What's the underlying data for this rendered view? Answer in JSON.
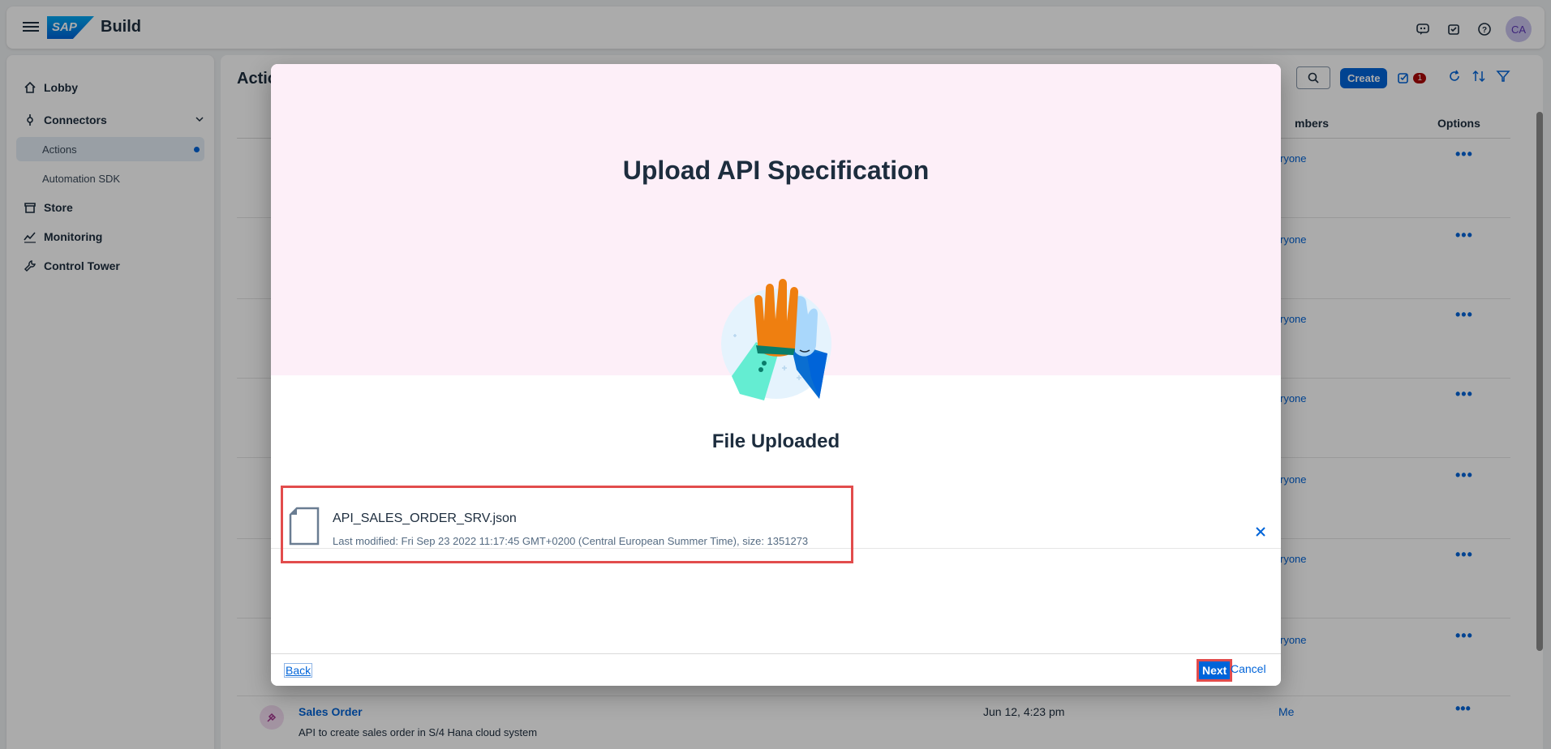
{
  "shell": {
    "brand_logo": "SAP",
    "brand_name": "Build",
    "avatar_initials": "CA"
  },
  "sidenav": {
    "items": [
      {
        "label": "Lobby",
        "icon": "home-icon"
      },
      {
        "label": "Connectors",
        "icon": "connector-icon"
      },
      {
        "label": "Actions",
        "icon": ""
      },
      {
        "label": "Automation SDK",
        "icon": ""
      },
      {
        "label": "Store",
        "icon": "store-icon"
      },
      {
        "label": "Monitoring",
        "icon": "monitoring-icon"
      },
      {
        "label": "Control Tower",
        "icon": "wrench-icon"
      }
    ]
  },
  "content": {
    "title": "Actio",
    "create_label": "Create",
    "notification_count": "1",
    "columns": {
      "members": "mbers",
      "options": "Options"
    },
    "row_member_partial": "ryone",
    "options_glyph": "•••",
    "last_row": {
      "name": "Sales Order",
      "description": "API to create sales order in S/4 Hana cloud system",
      "date": "Jun 12, 4:23 pm",
      "member": "Me"
    }
  },
  "dialog": {
    "title": "Upload API Specification",
    "subtitle": "File Uploaded",
    "file": {
      "name": "API_SALES_ORDER_SRV.json",
      "meta": "Last modified: Fri Sep 23 2022 11:17:45 GMT+0200 (Central European Summer Time), size: 1351273"
    },
    "back_label": "Back",
    "next_label": "Next",
    "cancel_label": "Cancel"
  },
  "colors": {
    "accent": "#0064d9",
    "hero_bg": "#fdeff8",
    "highlight": "#e24c4c"
  }
}
